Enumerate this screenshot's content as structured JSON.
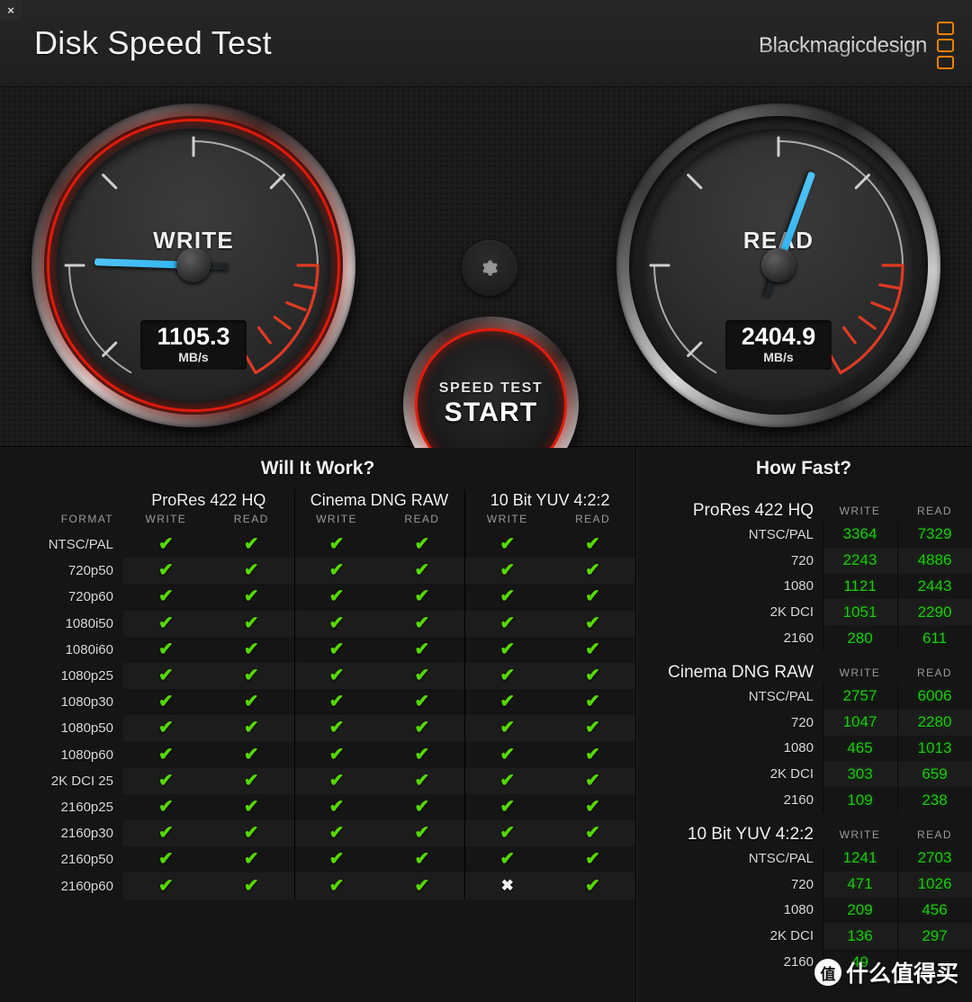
{
  "window": {
    "close_label": "×"
  },
  "header": {
    "title": "Disk Speed Test",
    "logo_text": "Blackmagicdesign",
    "logo_accent": "#f08000"
  },
  "gauges": {
    "write": {
      "label": "WRITE",
      "value": "1105.3",
      "unit": "MB/s",
      "needle_angle_deg": 182,
      "active": true
    },
    "read": {
      "label": "READ",
      "value": "2404.9",
      "unit": "MB/s",
      "needle_angle_deg": 290,
      "active": false
    },
    "accent_red": "#e01b0b",
    "needle_blue": "#35b6f2"
  },
  "controls": {
    "gear_icon": "gear-icon",
    "start_line1": "SPEED TEST",
    "start_line2": "START"
  },
  "will_it_work": {
    "title": "Will It Work?",
    "format_header": "FORMAT",
    "groups": [
      {
        "name": "ProRes 422 HQ",
        "columns": [
          "WRITE",
          "READ"
        ]
      },
      {
        "name": "Cinema DNG RAW",
        "columns": [
          "WRITE",
          "READ"
        ]
      },
      {
        "name": "10 Bit YUV 4:2:2",
        "columns": [
          "WRITE",
          "READ"
        ]
      }
    ],
    "ok_glyph": "✔",
    "fail_glyph": "✖",
    "rows": [
      {
        "format": "NTSC/PAL",
        "cells": [
          true,
          true,
          true,
          true,
          true,
          true
        ]
      },
      {
        "format": "720p50",
        "cells": [
          true,
          true,
          true,
          true,
          true,
          true
        ]
      },
      {
        "format": "720p60",
        "cells": [
          true,
          true,
          true,
          true,
          true,
          true
        ]
      },
      {
        "format": "1080i50",
        "cells": [
          true,
          true,
          true,
          true,
          true,
          true
        ]
      },
      {
        "format": "1080i60",
        "cells": [
          true,
          true,
          true,
          true,
          true,
          true
        ]
      },
      {
        "format": "1080p25",
        "cells": [
          true,
          true,
          true,
          true,
          true,
          true
        ]
      },
      {
        "format": "1080p30",
        "cells": [
          true,
          true,
          true,
          true,
          true,
          true
        ]
      },
      {
        "format": "1080p50",
        "cells": [
          true,
          true,
          true,
          true,
          true,
          true
        ]
      },
      {
        "format": "1080p60",
        "cells": [
          true,
          true,
          true,
          true,
          true,
          true
        ]
      },
      {
        "format": "2K DCI 25",
        "cells": [
          true,
          true,
          true,
          true,
          true,
          true
        ]
      },
      {
        "format": "2160p25",
        "cells": [
          true,
          true,
          true,
          true,
          true,
          true
        ]
      },
      {
        "format": "2160p30",
        "cells": [
          true,
          true,
          true,
          true,
          true,
          true
        ]
      },
      {
        "format": "2160p50",
        "cells": [
          true,
          true,
          true,
          true,
          true,
          true
        ]
      },
      {
        "format": "2160p60",
        "cells": [
          true,
          true,
          true,
          true,
          false,
          true
        ]
      }
    ]
  },
  "how_fast": {
    "title": "How Fast?",
    "write_header": "WRITE",
    "read_header": "READ",
    "sections": [
      {
        "name": "ProRes 422 HQ",
        "rows": [
          {
            "label": "NTSC/PAL",
            "write": "3364",
            "read": "7329"
          },
          {
            "label": "720",
            "write": "2243",
            "read": "4886"
          },
          {
            "label": "1080",
            "write": "1121",
            "read": "2443"
          },
          {
            "label": "2K DCI",
            "write": "1051",
            "read": "2290"
          },
          {
            "label": "2160",
            "write": "280",
            "read": "611"
          }
        ]
      },
      {
        "name": "Cinema DNG RAW",
        "rows": [
          {
            "label": "NTSC/PAL",
            "write": "2757",
            "read": "6006"
          },
          {
            "label": "720",
            "write": "1047",
            "read": "2280"
          },
          {
            "label": "1080",
            "write": "465",
            "read": "1013"
          },
          {
            "label": "2K DCI",
            "write": "303",
            "read": "659"
          },
          {
            "label": "2160",
            "write": "109",
            "read": "238"
          }
        ]
      },
      {
        "name": "10 Bit YUV 4:2:2",
        "rows": [
          {
            "label": "NTSC/PAL",
            "write": "1241",
            "read": "2703"
          },
          {
            "label": "720",
            "write": "471",
            "read": "1026"
          },
          {
            "label": "1080",
            "write": "209",
            "read": "456"
          },
          {
            "label": "2K DCI",
            "write": "136",
            "read": "297"
          },
          {
            "label": "2160",
            "write": "49",
            "read": ""
          }
        ]
      }
    ]
  },
  "watermark": {
    "mark": "值",
    "text": "什么值得买"
  }
}
